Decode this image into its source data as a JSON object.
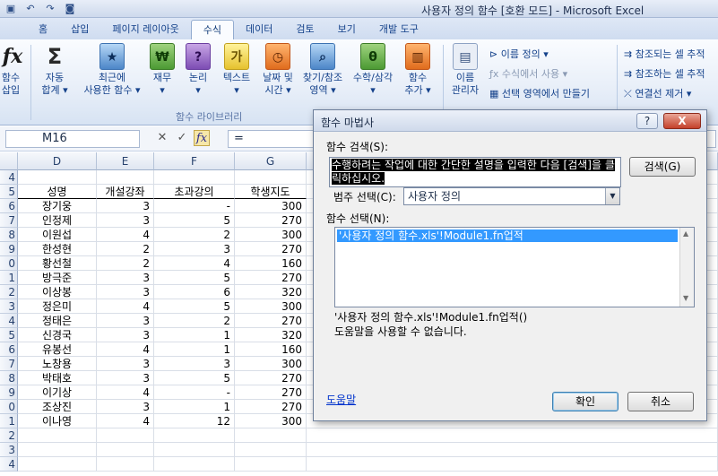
{
  "window": {
    "title": "사용자 정의 함수  [호환 모드] - Microsoft Excel",
    "qat_icons": [
      "save-icon",
      "undo-icon",
      "redo-icon",
      "camera-icon"
    ]
  },
  "tabs": [
    "홈",
    "삽입",
    "페이지 레이아웃",
    "수식",
    "데이터",
    "검토",
    "보기",
    "개발 도구"
  ],
  "active_tab": "수식",
  "ribbon": {
    "insert_fn": [
      "함수",
      "삽입"
    ],
    "autosum": [
      "자동",
      "합계 ▾"
    ],
    "recent": [
      "최근에",
      "사용한 함수 ▾"
    ],
    "finance": [
      "재무",
      "▾"
    ],
    "logical": [
      "논리",
      "▾"
    ],
    "text": [
      "텍스트",
      "▾"
    ],
    "datetime": [
      "날짜 및",
      "시간 ▾"
    ],
    "lookup": [
      "찾기/참조",
      "영역 ▾"
    ],
    "math": [
      "수학/삼각",
      "▾"
    ],
    "more": [
      "함수",
      "추가 ▾"
    ],
    "group_label": "함수 라이브러리",
    "name_manager": [
      "이름",
      "관리자"
    ],
    "define_name": "이름 정의 ▾",
    "use_in_formula": "수식에서 사용 ▾",
    "create_from_sel": "선택 영역에서 만들기",
    "trace_precedents": "참조되는 셀 추적",
    "trace_dependents": "참조하는 셀 추적",
    "remove_arrows": "연결선 제거 ▾"
  },
  "formula_bar": {
    "name_box": "M16",
    "content": "="
  },
  "sheet": {
    "columns": [
      "D",
      "E",
      "F",
      "G"
    ],
    "row_numbers": [
      "4",
      "5",
      "6",
      "7",
      "8",
      "9",
      "0",
      "1",
      "2",
      "3",
      "4",
      "5",
      "6",
      "7",
      "8",
      "9",
      "0",
      "1",
      "2",
      "3",
      "4"
    ],
    "header": [
      "성명",
      "개설강좌",
      "초과강의",
      "학생지도"
    ],
    "rows": [
      [
        "장기웅",
        "3",
        "-",
        "300"
      ],
      [
        "인정제",
        "3",
        "5",
        "270"
      ],
      [
        "이원섭",
        "4",
        "2",
        "300"
      ],
      [
        "한성현",
        "2",
        "3",
        "270"
      ],
      [
        "황선철",
        "2",
        "4",
        "160"
      ],
      [
        "방극준",
        "3",
        "5",
        "270"
      ],
      [
        "이상봉",
        "3",
        "6",
        "320"
      ],
      [
        "정은미",
        "4",
        "5",
        "300"
      ],
      [
        "정태은",
        "3",
        "2",
        "270"
      ],
      [
        "신경국",
        "3",
        "1",
        "320"
      ],
      [
        "유봉선",
        "4",
        "1",
        "160"
      ],
      [
        "노창용",
        "3",
        "3",
        "300"
      ],
      [
        "박태호",
        "3",
        "5",
        "270"
      ],
      [
        "이기상",
        "4",
        "-",
        "270"
      ],
      [
        "조상진",
        "3",
        "1",
        "270"
      ],
      [
        "이나영",
        "4",
        "12",
        "300"
      ]
    ]
  },
  "dialog": {
    "title": "함수 마법사",
    "search_label": "함수 검색(S):",
    "search_text": "수행하려는 작업에 대한 간단한 설명을 입력한 다음 [검색]을 클릭하십시오.",
    "search_button": "검색(G)",
    "category_label": "범주 선택(C):",
    "category_value": "사용자 정의",
    "function_label": "함수 선택(N):",
    "function_item": "'사용자 정의 함수.xls'!Module1.fn업적",
    "signature": "'사용자 정의 함수.xls'!Module1.fn업적()",
    "help_unavailable": "도움말을 사용할 수 없습니다.",
    "help_link": "도움말",
    "ok_button": "확인",
    "cancel_button": "취소",
    "help_btn": "?",
    "close_btn": "X"
  }
}
